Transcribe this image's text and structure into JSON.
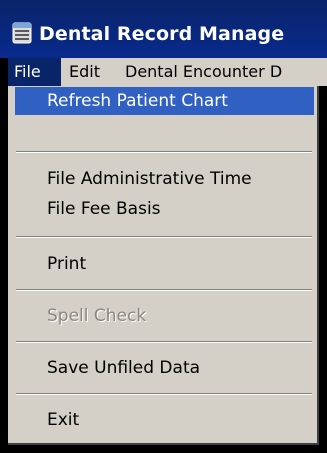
{
  "window": {
    "title": "Dental Record Manage",
    "icon": "dental-app-icon"
  },
  "menubar": {
    "items": [
      {
        "label": "File",
        "active": true
      },
      {
        "label": "Edit",
        "active": false
      },
      {
        "label": "Dental Encounter D",
        "active": false
      }
    ]
  },
  "file_menu": {
    "items": [
      {
        "label": "Refresh Patient Chart",
        "selected": true,
        "enabled": true
      },
      {
        "label": "File Administrative Time",
        "selected": false,
        "enabled": true
      },
      {
        "label": "File Fee Basis",
        "selected": false,
        "enabled": true
      },
      {
        "label": "Print",
        "selected": false,
        "enabled": true
      },
      {
        "label": "Spell Check",
        "selected": false,
        "enabled": false
      },
      {
        "label": "Save Unfiled Data",
        "selected": false,
        "enabled": true
      },
      {
        "label": "Exit",
        "selected": false,
        "enabled": true
      }
    ]
  },
  "colors": {
    "titlebar": "#0a246a",
    "selection": "#3160c3",
    "menu_background": "#d4d0c8",
    "disabled_text": "#8a877f"
  }
}
